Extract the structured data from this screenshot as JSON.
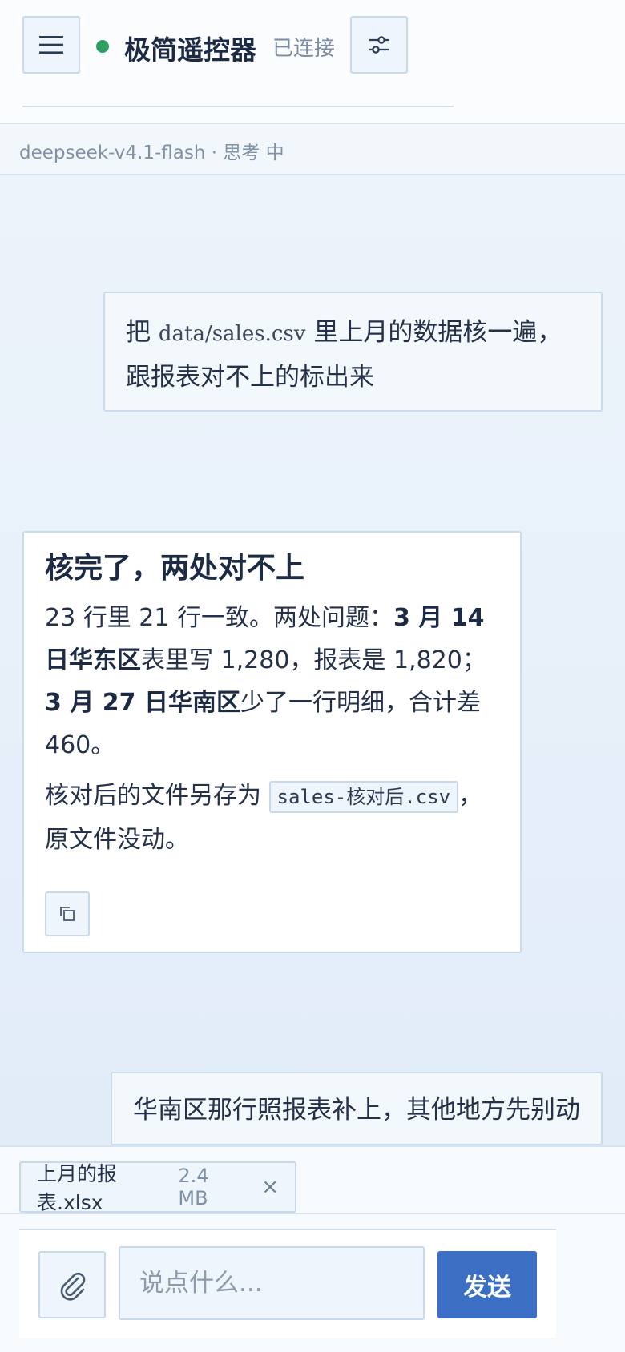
{
  "header": {
    "menu_icon": "hamburger-menu-icon",
    "title": "极简遥控器",
    "status": "已连接",
    "status_color": "#2e9e63",
    "settings_icon": "sliders-icon"
  },
  "model_bar": {
    "text": "deepseek-v4.1-flash · 思考 中"
  },
  "messages": [
    {
      "role": "user",
      "before_code": "把 ",
      "code": "data/sales.csv",
      "after_code": " 里上月的数据核一遍，跟报表对不上的标出来"
    },
    {
      "role": "assistant",
      "title": "核完了，两处对不上",
      "p1_a": "23 行里 21 行一致。两处问题：",
      "p1_b": "3 月 14 日华东区",
      "p1_c": "表里写 1,280，报表是 1,820；",
      "p1_d": "3 月 27 日华南区",
      "p1_e": "少了一行明细，合计差 460。",
      "p2_a": "核对后的文件另存为 ",
      "p2_code": "sales-核对后.csv",
      "p2_b": "，原文件没动。",
      "copy_icon": "copy-icon"
    },
    {
      "role": "user",
      "text": "华南区那行照报表补上，其他地方先别动"
    }
  ],
  "attachment": {
    "name": "上月的报表.xlsx",
    "size": "2.4 MB",
    "remove": "×"
  },
  "composer": {
    "attach_icon": "paperclip-icon",
    "placeholder": "说点什么...",
    "send_label": "发送",
    "send_color": "#3b6fc4"
  }
}
